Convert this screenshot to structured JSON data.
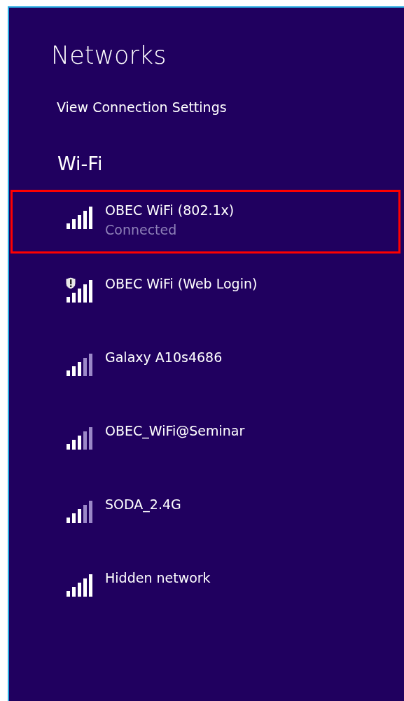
{
  "title": "Networks",
  "settings_link": "View Connection Settings",
  "section": "Wi-Fi",
  "networks": [
    {
      "name": "OBEC WiFi (802.1x)",
      "status": "Connected",
      "selected": true,
      "kind": "strong",
      "warning": false
    },
    {
      "name": "OBEC WiFi (Web Login)",
      "selected": false,
      "kind": "strong",
      "warning": true
    },
    {
      "name": "Galaxy A10s4686",
      "selected": false,
      "kind": "medium",
      "warning": false
    },
    {
      "name": "OBEC_WiFi@Seminar",
      "selected": false,
      "kind": "medium",
      "warning": false
    },
    {
      "name": "SODA_2.4G",
      "selected": false,
      "kind": "medium",
      "warning": false
    },
    {
      "name": "Hidden network",
      "selected": false,
      "kind": "strong",
      "warning": false
    }
  ]
}
